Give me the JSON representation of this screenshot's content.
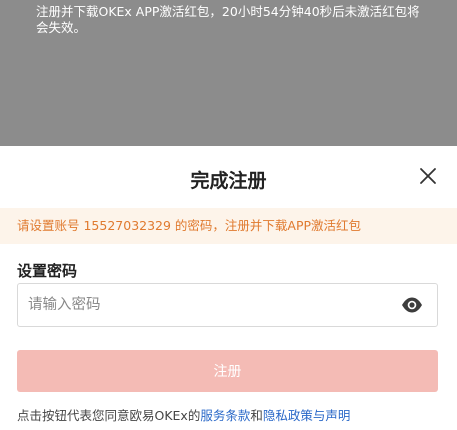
{
  "backdrop": {
    "text": "注册并下载OKEx APP激活红包，20小时54分钟40秒后未激活红包将会失效。"
  },
  "sheet": {
    "title": "完成注册",
    "notice": "请设置账号 15527032329 的密码，注册并下载APP激活红包",
    "password_label": "设置密码",
    "password_value": "",
    "password_placeholder": "请输入密码",
    "submit_label": "注册",
    "terms_prefix": "点击按钮代表您同意欧易OKEx的",
    "terms_link_service": "服务条款",
    "terms_and": "和",
    "terms_link_privacy": "隐私政策与声明"
  },
  "icons": {
    "close": "close-icon",
    "eye": "eye-icon"
  },
  "colors": {
    "backdrop": "#8c8c8c",
    "notice_bg": "#fdf4ea",
    "notice_text": "#e07a2f",
    "button_bg": "#f4bbb5",
    "link": "#2a68c8"
  }
}
